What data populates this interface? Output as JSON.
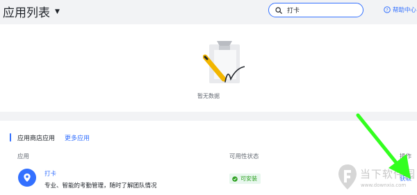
{
  "header": {
    "title": "应用列表",
    "search": {
      "value": "打卡",
      "placeholder": ""
    },
    "help_label": "帮助中心"
  },
  "empty_state": {
    "text": "暂无数据"
  },
  "store": {
    "title": "应用商店应用",
    "more_link": "更多应用",
    "columns": {
      "app": "应用",
      "status": "可用性状态",
      "operation": "操作"
    },
    "rows": [
      {
        "name": "打卡",
        "description": "专业、智能的考勤管理，随时了解团队情况",
        "status": "可安装",
        "action": "获取"
      }
    ]
  },
  "watermark": {
    "brand": "当下软件园",
    "url": "www.downxia.com"
  },
  "colors": {
    "accent": "#3370ff",
    "status_green": "#2ea121",
    "annotation_arrow": "#33ff1f"
  }
}
